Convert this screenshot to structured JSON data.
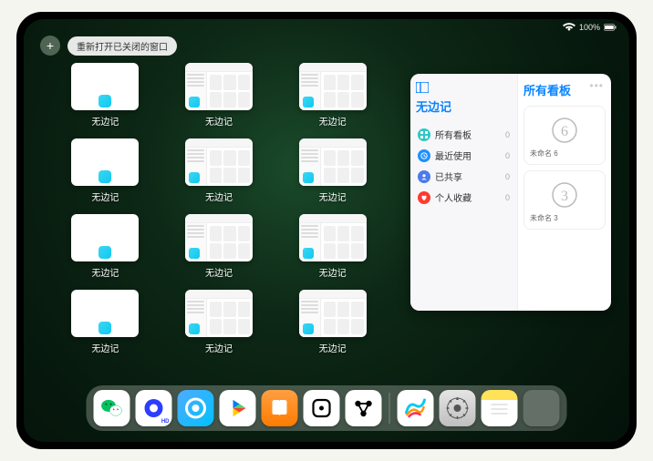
{
  "status": {
    "battery": "100%",
    "wifi": "signal-icon"
  },
  "controls": {
    "plus": "+",
    "reopen_label": "重新打开已关闭的窗口"
  },
  "app_name": "无边记",
  "windows": [
    {
      "label": "无边记",
      "variant": "blank"
    },
    {
      "label": "无边记",
      "variant": "detail"
    },
    {
      "label": "无边记",
      "variant": "detail"
    },
    {
      "label": "无边记",
      "variant": "blank"
    },
    {
      "label": "无边记",
      "variant": "detail"
    },
    {
      "label": "无边记",
      "variant": "detail"
    },
    {
      "label": "无边记",
      "variant": "blank"
    },
    {
      "label": "无边记",
      "variant": "detail"
    },
    {
      "label": "无边记",
      "variant": "detail"
    },
    {
      "label": "无边记",
      "variant": "blank"
    },
    {
      "label": "无边记",
      "variant": "detail"
    },
    {
      "label": "无边记",
      "variant": "detail"
    }
  ],
  "side_panel": {
    "left_title": "无边记",
    "right_title": "所有看板",
    "filters": [
      {
        "name": "所有看板",
        "count": 0,
        "color": "#30c7c4",
        "icon": "grid"
      },
      {
        "name": "最近使用",
        "count": 0,
        "color": "#1e90ff",
        "icon": "clock"
      },
      {
        "name": "已共享",
        "count": 0,
        "color": "#4b7bec",
        "icon": "person"
      },
      {
        "name": "个人收藏",
        "count": 0,
        "color": "#ff3b30",
        "icon": "heart"
      }
    ],
    "boards": [
      {
        "label": "未命名 6",
        "digit": "6"
      },
      {
        "label": "未命名 3",
        "digit": "3"
      }
    ]
  },
  "dock": [
    {
      "name": "wechat-icon"
    },
    {
      "name": "quark-icon"
    },
    {
      "name": "qqbrowser-icon"
    },
    {
      "name": "play-icon"
    },
    {
      "name": "books-icon"
    },
    {
      "name": "dice-icon"
    },
    {
      "name": "connect-icon"
    },
    {
      "name": "freeform-icon"
    },
    {
      "name": "settings-icon"
    },
    {
      "name": "notes-icon"
    },
    {
      "name": "app-library-icon"
    }
  ]
}
